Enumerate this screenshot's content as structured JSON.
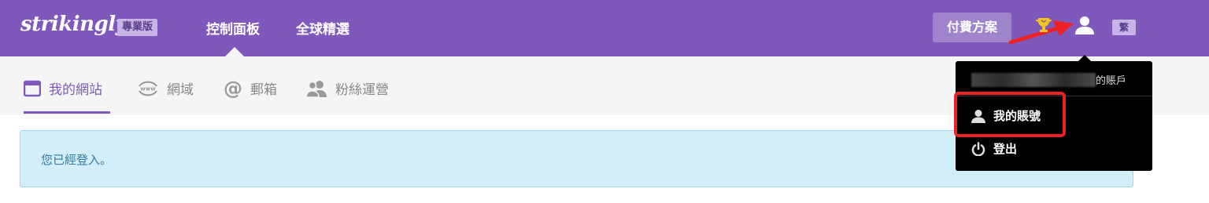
{
  "topbar": {
    "logo": "strikingly",
    "edition_badge": "專業版",
    "nav": [
      {
        "label": "控制面板"
      },
      {
        "label": "全球精選"
      }
    ],
    "plan_button": "付費方案",
    "lang_button": "繁"
  },
  "subnav": {
    "tabs": [
      {
        "label": "我的網站",
        "icon": "browser-window-icon",
        "active": true
      },
      {
        "label": "網域",
        "icon": "www-icon",
        "active": false
      },
      {
        "label": "郵箱",
        "icon": "at-sign-icon",
        "active": false
      },
      {
        "label": "粉絲運營",
        "icon": "users-icon",
        "active": false
      }
    ]
  },
  "notice": {
    "text": "您已經登入。"
  },
  "dropdown": {
    "account_header_suffix": "的賬戶",
    "items": [
      {
        "label": "我的賬號",
        "icon": "user-icon"
      },
      {
        "label": "登出",
        "icon": "power-icon"
      }
    ]
  },
  "colors": {
    "brand_purple": "#7f58bb",
    "notice_bg": "#d2eef8",
    "notice_text": "#2f7c9f",
    "highlight_red": "#ee2222"
  }
}
